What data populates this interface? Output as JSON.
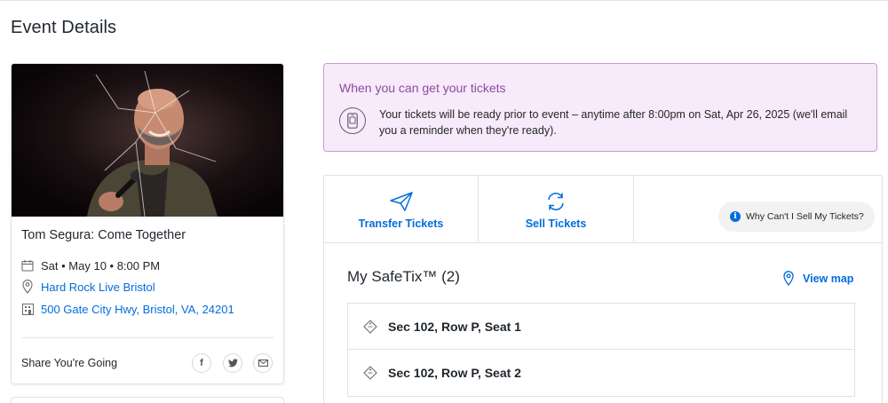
{
  "page": {
    "title": "Event Details"
  },
  "event": {
    "name": "Tom Segura: Come Together",
    "date": "Sat • May 10 • 8:00 PM",
    "venue": "Hard Rock Live Bristol",
    "address": "500 Gate City Hwy, Bristol, VA, 24201",
    "share_label": "Share You're Going",
    "image_icon": "performer-photo"
  },
  "notice": {
    "title": "When you can get your tickets",
    "text": "Your tickets will be ready prior to event – anytime after 8:00pm on Sat, Apr 26, 2025 (we'll email you a reminder when they're ready).",
    "icon": "phone-ticket-icon"
  },
  "actions": {
    "transfer_label": "Transfer Tickets",
    "sell_label": "Sell Tickets",
    "why_label": "Why Can't I Sell My Tickets?"
  },
  "tickets": {
    "title": "My SafeTix™",
    "count": "(2)",
    "view_map_label": "View map",
    "seats": [
      {
        "label": "Sec 102, Row P, Seat 1"
      },
      {
        "label": "Sec 102, Row P, Seat 2"
      }
    ]
  },
  "colors": {
    "link": "#026cdf",
    "notice_bg": "#f7eafb",
    "notice_border": "#c99ad6",
    "notice_title": "#8a4b9c"
  }
}
